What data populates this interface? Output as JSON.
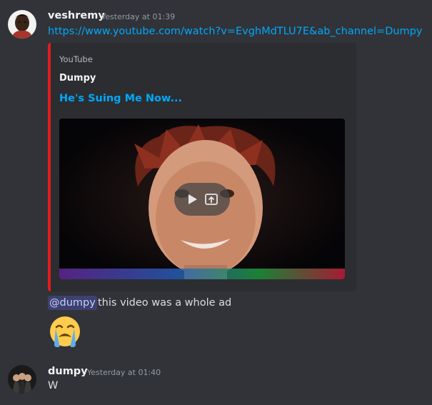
{
  "messages": [
    {
      "author": "veshremy",
      "timestamp": "Yesterday at 01:39",
      "link": "https://www.youtube.com/watch?v=EvghMdTLU7E&ab_channel=Dumpy",
      "embed": {
        "provider": "YouTube",
        "author": "Dumpy",
        "title": "He's Suing Me Now...",
        "accent_color": "#e41c1c"
      },
      "mention": "@dumpy",
      "text": "this video was a whole ad",
      "emoji": "loudly-crying-face"
    },
    {
      "author": "dumpy",
      "timestamp": "Yesterday at 01:40",
      "text": "W"
    }
  ],
  "colors": {
    "background": "#313338",
    "link": "#00a8fc",
    "embed_bg": "#2b2d31",
    "mention_bg": "#3c4270"
  }
}
